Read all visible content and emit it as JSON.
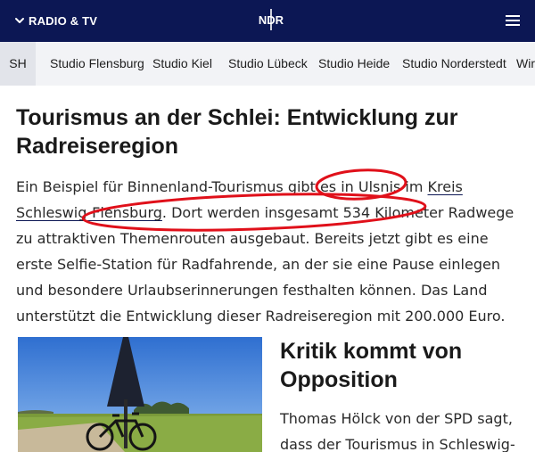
{
  "topbar": {
    "radio_tv_label": "RADIO & TV",
    "logo_text": "NDR",
    "brand_color": "#0c1754"
  },
  "tabs": [
    {
      "label": "SH",
      "selected": true
    },
    {
      "label": "Studio Flensburg"
    },
    {
      "label": "Studio Kiel"
    },
    {
      "label": "Studio Lübeck"
    },
    {
      "label": "Studio Heide"
    },
    {
      "label": "Studio Norderstedt"
    },
    {
      "label": "Wir"
    }
  ],
  "article": {
    "headline": "Tourismus an der Schlei: Entwicklung zur Radreiseregion",
    "para": {
      "p1": "Ein Beispiel für Binnenland-Tourismus gibt es in Ulsnis im ",
      "link": "Kreis Schleswig-Flensburg",
      "p2": ". Dort werden insgesamt 534 Kilometer Radwege zu attraktiven Themenrouten ausgebaut. Bereits jetzt gibt es eine erste Selfie-Station für Radfahrende, an der sie eine Pause einlegen und besondere Urlaubserinnerungen festhalten können. Das Land unterstützt die Entwicklung dieser Radreiseregion mit 200.000 Euro."
    },
    "annotation_color": "#e0101a"
  },
  "section2": {
    "subhead": "Kritik kommt von Opposition",
    "text": "Thomas Hölck von der SPD sagt, dass der Tourismus in Schleswig-"
  },
  "icons": {
    "chevron": "chevron-down-icon",
    "menu": "hamburger-menu-icon",
    "logo": "ndr-logo-icon"
  }
}
